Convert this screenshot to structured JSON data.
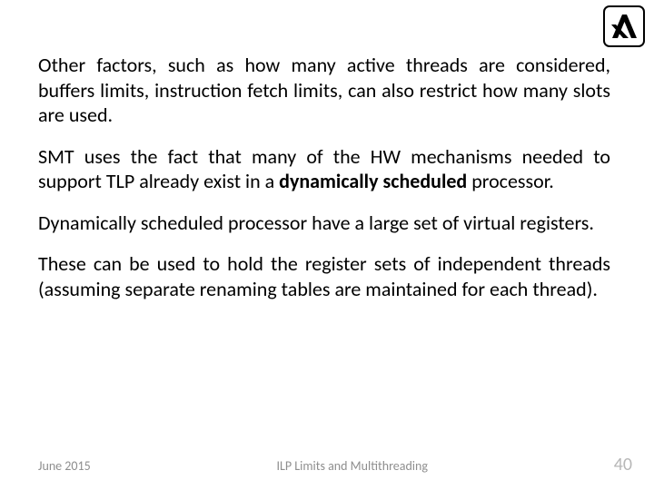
{
  "logo": {
    "alt": "institution-logo"
  },
  "paragraphs": {
    "p1": "Other factors, such as how many active threads are considered, buffers limits, instruction fetch limits, can also restrict how many slots are used.",
    "p2_pre": "SMT uses the fact that many of the HW mechanisms needed to support TLP already exist in a ",
    "p2_bold": "dynamically scheduled",
    "p2_post": " processor.",
    "p3": "Dynamically scheduled processor have a large set of virtual registers.",
    "p4": "These can be used to hold the register sets of independent threads (assuming separate renaming tables are maintained for each thread)."
  },
  "footer": {
    "date": "June 2015",
    "title": "ILP Limits and Multithreading",
    "page": "40"
  }
}
